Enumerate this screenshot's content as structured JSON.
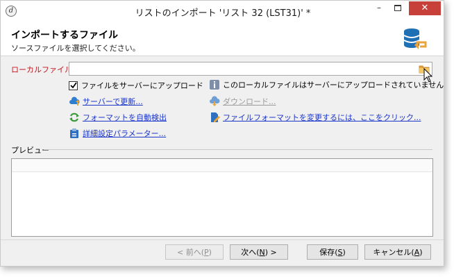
{
  "window": {
    "title": "リストのインポート 'リスト 32 (LST31)' *"
  },
  "titlebar": {
    "app_icon_glyph": "d",
    "minimize": "–",
    "close": "✕"
  },
  "header": {
    "title": "インポートするファイル",
    "subtitle": "ソースファイルを選択してください。",
    "icon": "database-import-icon"
  },
  "form": {
    "local_file_label": "ローカルファイル:",
    "local_file_value": "",
    "upload_checkbox": {
      "label": "ファイルをサーバーにアップロード",
      "checked": true
    },
    "not_uploaded_info": "このローカルファイルはサーバーにアップロードされていません",
    "links": {
      "update_on_server": "サーバーで更新...",
      "download": "ダウンロード...",
      "auto_detect_format": "フォーマットを自動検出",
      "change_file_format": "ファイルフォーマットを変更するには、ここをクリック...",
      "advanced_parameters": "詳細設定パラメーター..."
    }
  },
  "preview": {
    "label": "プレビュー"
  },
  "buttons": {
    "prev": {
      "text": "< 前へ(",
      "key": "P",
      "end": ")",
      "enabled": false
    },
    "next": {
      "text": "次へ(",
      "key": "N",
      "end": ") >"
    },
    "save": {
      "text": "保存(",
      "key": "S",
      "end": ")"
    },
    "cancel": {
      "text": "キャンセル(",
      "key": "A",
      "end": ")"
    }
  },
  "colors": {
    "required_label": "#c0161e",
    "link": "#1b35c9",
    "close_button": "#c7413a",
    "icon_blue": "#1f6fb5",
    "icon_orange": "#e8a33a"
  }
}
